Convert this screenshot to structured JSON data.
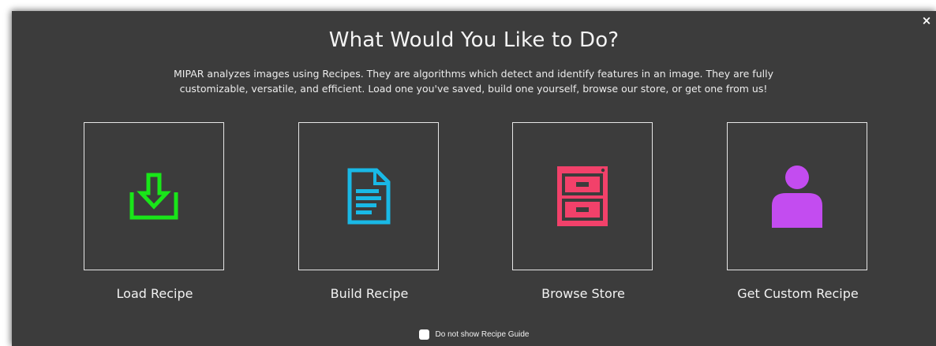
{
  "dialog": {
    "close_label": "×",
    "title": "What Would You Like to Do?",
    "description": "MIPAR analyzes images using Recipes. They are algorithms which detect and identify features in an image. They are fully customizable, versatile, and efficient. Load one you've saved, build one yourself, browse our store, or get one from us!"
  },
  "options": [
    {
      "label": "Load Recipe",
      "icon": "download-tray-icon",
      "color": "#19e619"
    },
    {
      "label": "Build Recipe",
      "icon": "document-icon",
      "color": "#19b9e6"
    },
    {
      "label": "Browse Store",
      "icon": "filing-cabinet-icon",
      "color": "#f2416a"
    },
    {
      "label": "Get Custom Recipe",
      "icon": "person-icon",
      "color": "#c34cf0"
    }
  ],
  "footer": {
    "checkbox_checked": false,
    "checkbox_label": "Do not show Recipe Guide"
  }
}
